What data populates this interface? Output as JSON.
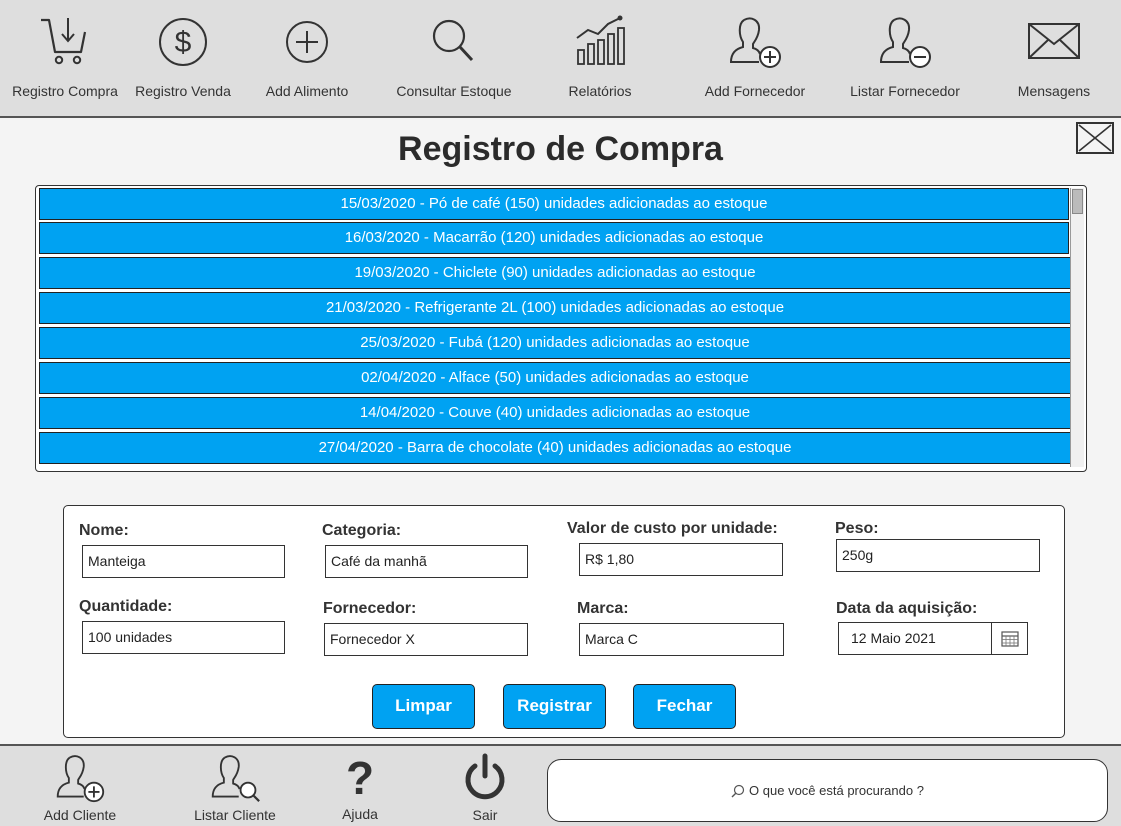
{
  "toolbar": {
    "items": [
      {
        "label": "Registro Compra",
        "icon": "cart-icon"
      },
      {
        "label": "Registro Venda",
        "icon": "dollar-icon"
      },
      {
        "label": "Add Alimento",
        "icon": "plus-circle-icon"
      },
      {
        "label": "Consultar Estoque",
        "icon": "search-icon"
      },
      {
        "label": "Relatórios",
        "icon": "chart-icon"
      },
      {
        "label": "Add Fornecedor",
        "icon": "user-add-icon"
      },
      {
        "label": "Listar Fornecedor",
        "icon": "user-remove-icon"
      },
      {
        "label": "Mensagens",
        "icon": "envelope-icon"
      }
    ]
  },
  "main": {
    "title": "Registro de Compra",
    "list": [
      "15/03/2020 - Pó de café (150) unidades adicionadas ao estoque",
      "16/03/2020 - Macarrão (120) unidades adicionadas ao estoque",
      "19/03/2020 - Chiclete (90) unidades adicionadas ao estoque",
      "21/03/2020 - Refrigerante 2L (100) unidades adicionadas ao estoque",
      "25/03/2020 - Fubá (120) unidades adicionadas ao estoque",
      "02/04/2020 - Alface (50) unidades adicionadas ao estoque",
      "14/04/2020 - Couve (40) unidades adicionadas ao estoque",
      "27/04/2020 - Barra de chocolate (40) unidades adicionadas ao estoque"
    ]
  },
  "form": {
    "nome": {
      "label": "Nome:",
      "value": "Manteiga"
    },
    "categoria": {
      "label": "Categoria:",
      "value": "Café da manhã"
    },
    "valor": {
      "label": "Valor de custo por unidade:",
      "value": "R$ 1,80"
    },
    "peso": {
      "label": "Peso:",
      "value": "250g"
    },
    "quantidade": {
      "label": "Quantidade:",
      "value": "100 unidades"
    },
    "fornecedor": {
      "label": "Fornecedor:",
      "value": "Fornecedor X"
    },
    "marca": {
      "label": "Marca:",
      "value": "Marca C"
    },
    "data": {
      "label": "Data da aquisição:",
      "value": "12 Maio 2021"
    },
    "buttons": {
      "limpar": "Limpar",
      "registrar": "Registrar",
      "fechar": "Fechar"
    }
  },
  "bottom": {
    "items": [
      {
        "label": "Add Cliente",
        "icon": "user-add-icon"
      },
      {
        "label": "Listar Cliente",
        "icon": "user-search-icon"
      },
      {
        "label": "Ajuda",
        "icon": "question-icon"
      },
      {
        "label": "Sair",
        "icon": "power-icon"
      }
    ],
    "search_placeholder": "O que você está procurando ?"
  },
  "colors": {
    "accent": "#00a2f2",
    "toolbar_bg": "#dedede"
  }
}
